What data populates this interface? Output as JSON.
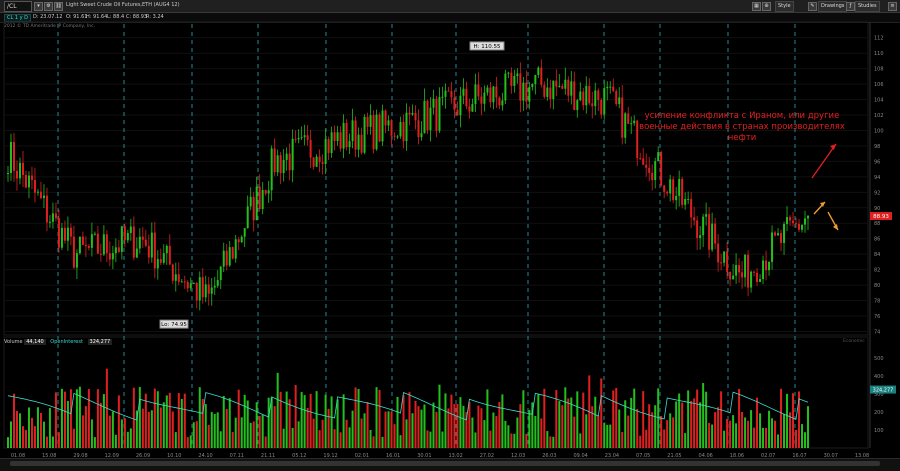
{
  "header": {
    "symbol": "/CL",
    "description": "Light Sweet Crude Oil Futures,ETH (AUG4 12)",
    "buttons": [
      {
        "name": "style",
        "label": "Style"
      },
      {
        "name": "drawings",
        "label": "Drawings"
      },
      {
        "name": "studies",
        "label": "Studies"
      }
    ]
  },
  "quote": {
    "date": "D: 23.07.12",
    "open": "O: 91.61",
    "high": "H: 91.64",
    "low": "L: 88.4",
    "close": "C: 88.93",
    "range": "R: 3.24"
  },
  "aggregation": "CL 1 y D",
  "copyright": "2012 © TD Ameritrade IP Company, Inc.",
  "chart_data": {
    "type": "candlestick",
    "series": [
      {
        "name": "CL price",
        "values": [
          {
            "x": "Jul-11",
            "y": 97
          },
          {
            "x": "Aug-11",
            "y": 84
          },
          {
            "x": "Sep-11",
            "y": 86
          },
          {
            "x": "Oct-11",
            "y": 78
          },
          {
            "x": "Nov-11",
            "y": 96
          },
          {
            "x": "Dec-11",
            "y": 99
          },
          {
            "x": "Jan-12",
            "y": 101
          },
          {
            "x": "Feb-12",
            "y": 104
          },
          {
            "x": "Mar-12",
            "y": 106
          },
          {
            "x": "Apr-12",
            "y": 104
          },
          {
            "x": "May-12",
            "y": 92
          },
          {
            "x": "Jun-12",
            "y": 81
          },
          {
            "x": "Jul-12",
            "y": 89
          }
        ]
      }
    ],
    "high_marker": "H: 110.55",
    "low_marker": "Lo: 74.95",
    "last_price": "88.93",
    "price_axis": [
      "112",
      "110",
      "108",
      "106",
      "104",
      "102",
      "100",
      "98",
      "96",
      "94",
      "92",
      "90",
      "88",
      "86",
      "84",
      "82",
      "80",
      "78",
      "76",
      "74"
    ],
    "ylim": [
      73.8,
      113
    ],
    "date_axis": [
      "01.08",
      "15.08",
      "29.08",
      "12.09",
      "26.09",
      "10.10",
      "24.10",
      "07.11",
      "21.11",
      "05.12",
      "19.12",
      "02.01",
      "16.01",
      "30.01",
      "13.02",
      "27.02",
      "12.03",
      "26.03",
      "09.04",
      "23.04",
      "07.05",
      "21.05",
      "04.06",
      "18.06",
      "02.07",
      "16.07",
      "30.07",
      "13.08"
    ],
    "volume_axis": [
      "500",
      "400",
      "300",
      "200",
      "100"
    ],
    "volume_label": "Volume",
    "volume_value": "44,140",
    "oi_label": "OpenInterest",
    "oi_value": "324,277",
    "oi_marker": "324,277"
  },
  "annotation": "усиление конфликта с Ираном, или другие военные действия в странах производителях нефти",
  "econ_label": "Economic",
  "colors": {
    "up": "#22c01c",
    "down": "#e02020",
    "oi": "#3cdcd0",
    "separator": "#2fa8b8",
    "annotation": "#e02020",
    "arrow_orange": "#f0a030"
  }
}
